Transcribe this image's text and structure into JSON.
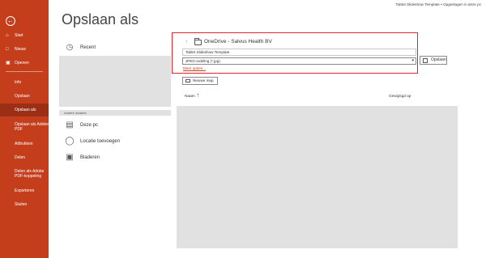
{
  "titlebar": {
    "text": "Tablet Slideshow Template • Opgeslagen in deze pc"
  },
  "page_title": "Opslaan als",
  "rail": {
    "back_icon": "back-arrow-icon",
    "items": [
      {
        "label": "Start",
        "icon": "home-icon"
      },
      {
        "label": "Nieuw",
        "icon": "new-document-icon"
      },
      {
        "label": "Openen",
        "icon": "folder-open-icon"
      },
      {
        "label": "Info"
      },
      {
        "label": "Opslaan"
      },
      {
        "label": "Opslaan als"
      },
      {
        "label": "Opslaan als Adobe PDF"
      },
      {
        "label": "Afdrukken"
      },
      {
        "label": "Delen"
      },
      {
        "label": "Delen als Adobe PDF-koppeling"
      },
      {
        "label": "Exporteren"
      },
      {
        "label": "Sluiten"
      }
    ]
  },
  "locations": {
    "recent": "Recent",
    "other_header": "Andere locaties",
    "this_pc": "Deze pc",
    "add_location": "Locatie toevoegen",
    "browse": "Bladeren"
  },
  "save_panel": {
    "location": "OneDrive - Salvus Health BV",
    "filename_value": "Tablet Slideshow Template",
    "filetype_value": "JPEG-indeling (*.jpg)",
    "more_options": "Meer opties...",
    "save_label": "Opslaan",
    "new_folder_label": "Nieuwe map",
    "col_name": "Naam",
    "col_modified": "Gewijzigd op"
  },
  "colors": {
    "accent": "#c43e1c",
    "active_item": "#9b2f15",
    "highlight_border": "#e0242b",
    "panel_gray": "#e1e1e1"
  }
}
